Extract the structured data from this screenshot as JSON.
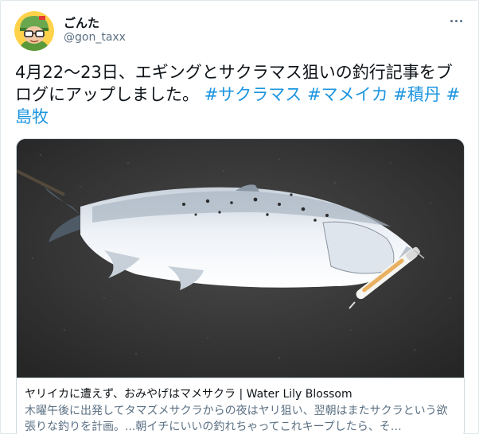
{
  "user": {
    "display_name": "ごんた",
    "handle": "@gon_taxx",
    "avatar_icon": "user-avatar-icon"
  },
  "menu": {
    "icon": "more-horizontal-icon"
  },
  "tweet": {
    "text_plain": "4月22〜23日、エギングとサクラマス狙いの釣行記事をブログにアップしました。",
    "hashtags": [
      "#サクラマス",
      "#マメイカ",
      "#積丹",
      "#島牧"
    ]
  },
  "card": {
    "image_icon": "salmon-with-lure-photo",
    "title": "ヤリイカに遭えず、おみやげはマメサクラ | Water Lily Blossom",
    "description": "木曜午後に出発してタマズメサクラからの夜はヤリ狙い、翌朝はまたサクラという欲張りな釣りを計画。...朝イチにいいの釣れちゃってこれキープしたら、そ…"
  },
  "colors": {
    "hashtag": "#1b95e0",
    "secondary_text": "#5b7083",
    "border": "#cfd9de"
  }
}
